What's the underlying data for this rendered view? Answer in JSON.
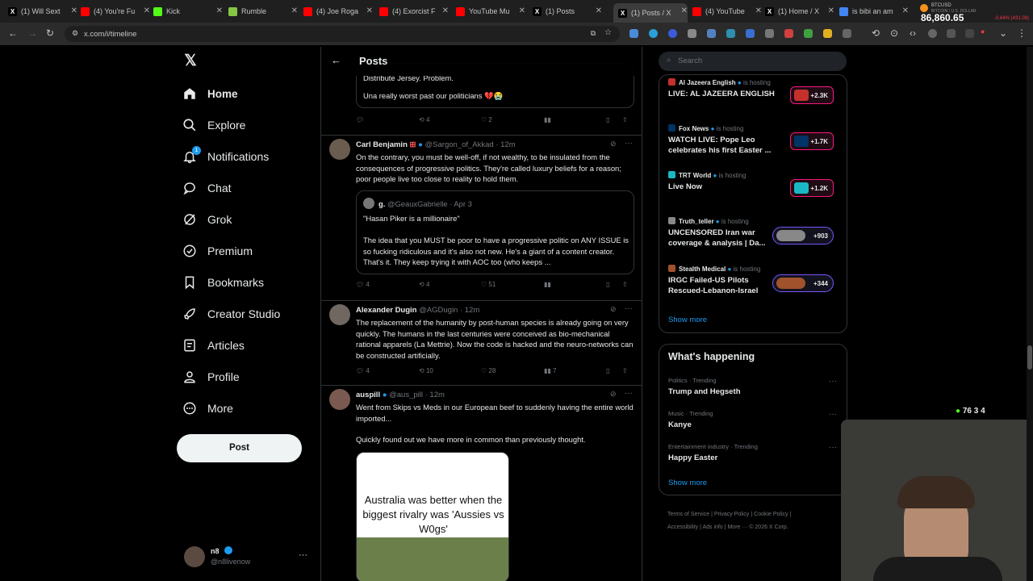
{
  "tabs": [
    {
      "label": "(1) Will Sext",
      "icon": "x-icon",
      "color": "#000000"
    },
    {
      "label": "(4) You're Fu",
      "icon": "youtube-icon",
      "color": "#ff0000"
    },
    {
      "label": "Kick",
      "icon": "kick-icon",
      "color": "#53fc18"
    },
    {
      "label": "Rumble",
      "icon": "rumble-icon",
      "color": "#85c742"
    },
    {
      "label": "(4) Joe Roga",
      "icon": "youtube-icon",
      "color": "#ff0000"
    },
    {
      "label": "(4) Exorcist F",
      "icon": "youtube-icon",
      "color": "#ff0000"
    },
    {
      "label": "YouTube Mu",
      "icon": "youtube-music-icon",
      "color": "#ff0000"
    },
    {
      "label": "(1) Posts",
      "icon": "x-icon",
      "color": "#000000"
    },
    {
      "label": "(1) Posts / X",
      "icon": "x-icon",
      "color": "#000000"
    },
    {
      "label": "(4) YouTube",
      "icon": "youtube-icon",
      "color": "#ff0000"
    },
    {
      "label": "(1) Home / X",
      "icon": "x-icon",
      "color": "#000000"
    },
    {
      "label": "is bibi an am",
      "icon": "google-icon",
      "color": "#4285f4"
    }
  ],
  "btc": {
    "symbol": "BTCUSD",
    "sub": "BITCOIN / U.S. DOLLAR",
    "price": "86,860.65",
    "change": "-0.64% (431.08)"
  },
  "url": "x.com/i/timeline",
  "nav": {
    "home": "Home",
    "explore": "Explore",
    "notifications": "Notifications",
    "chat": "Chat",
    "grok": "Grok",
    "premium": "Premium",
    "bookmarks": "Bookmarks",
    "creator": "Creator Studio",
    "articles": "Articles",
    "profile": "Profile",
    "more": "More",
    "post": "Post",
    "notif_count": "1"
  },
  "me": {
    "name": "n8",
    "handle": "@n8livenow"
  },
  "feed": {
    "title": "Posts",
    "top_fragment": "Distribute Jersey. Problem.",
    "top_text": "Una really worst past our politicians 💔😭",
    "top_acts": {
      "replies": "",
      "reposts": "4",
      "likes": "2"
    },
    "tweets": [
      {
        "name": "Carl Benjamin",
        "handle": "@Sargon_of_Akkad · 12m",
        "text": "On the contrary, you must be well-off, if not wealthy, to be insulated from the consequences of progressive politics. They're called luxury beliefs for a reason; poor people live too close to reality to hold them.",
        "quote": {
          "name": "g.",
          "handle": "@GeauxGabrielle · Apr 3",
          "line1": "\"Hasan Piker is a millionaire\"",
          "line2": "The idea that you MUST be poor to have a progressive politic on ANY ISSUE is so fucking ridiculous and it's also not new. He's a giant of a content creator. That's it. They keep trying it with AOC too (who keeps ..."
        },
        "replies": "4",
        "reposts": "4",
        "likes": "51"
      },
      {
        "name": "Alexander Dugin",
        "handle": "@AGDugin · 12m",
        "text": "The replacement of the humanity by post-human species is already going on very quickly. The humans in the last centuries were conceived as bio-mechanical rational apparels (La Mettrie). Now the code is hacked and the neuro-networks can be constructed artificially.",
        "replies": "4",
        "reposts": "10",
        "likes": "28",
        "views": "7"
      },
      {
        "name": "auspill",
        "handle": "@aus_pill · 12m",
        "text": "Went from Skips vs Meds in our European beef to suddenly having the entire world imported...",
        "text2": "Quickly found out we have more in common than previously thought.",
        "media": "Australia was better when the biggest rivalry was 'Aussies vs W0gs'"
      }
    ]
  },
  "search": {
    "placeholder": "Search"
  },
  "live": [
    {
      "name": "Al Jazeera English",
      "status": "is hosting",
      "title": "LIVE: AL JAZEERA ENGLISH",
      "count": "+2.3K",
      "color": "#c4302b"
    },
    {
      "name": "Fox News",
      "status": "is hosting",
      "title": "WATCH LIVE: Pope Leo celebrates his first Easter ...",
      "count": "+1.7K",
      "color": "#003366"
    },
    {
      "name": "TRT World",
      "status": "is hosting",
      "title": "Live Now",
      "count": "+1.2K",
      "color": "#1ab8c4"
    },
    {
      "name": "Truth_teller",
      "status": "is hosting",
      "title": "UNCENSORED Iran war coverage & analysis | Da...",
      "count": "+903",
      "color": "#888888"
    },
    {
      "name": "Stealth Medical",
      "status": "is hosting",
      "title": "IRGC Failed-US Pilots Rescued-Lebanon-Israel",
      "count": "+344",
      "color": "#a0522d"
    }
  ],
  "show_more": "Show more",
  "happening": {
    "title": "What's happening",
    "items": [
      {
        "cat": "Politics · Trending",
        "name": "Trump and Hegseth"
      },
      {
        "cat": "Music · Trending",
        "name": "Kanye"
      },
      {
        "cat": "Entertainment industry · Trending",
        "name": "Happy Easter"
      }
    ],
    "show_more": "Show more"
  },
  "footer": {
    "terms": "Terms of Service",
    "privacy": "Privacy Policy",
    "cookie": "Cookie Policy",
    "access": "Accessibility",
    "ads": "Ads info",
    "more": "More ···",
    "copy": "© 2026 X Corp."
  },
  "overlay": {
    "counter": "76  3  4"
  }
}
